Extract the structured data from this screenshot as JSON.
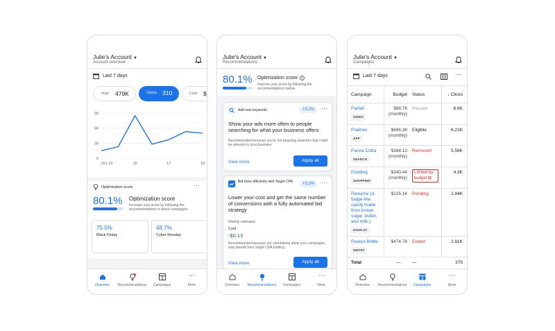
{
  "colors": {
    "accent": "#1a73e8",
    "error": "#d93025",
    "chart_line": "#1a73e8"
  },
  "phone1": {
    "account": "Julie's Account",
    "subtitle": "Account overview",
    "date_range": "Last 7 days",
    "metrics": [
      {
        "label": "Impr.",
        "value": "479K"
      },
      {
        "label": "Clicks",
        "value": "310"
      },
      {
        "label": "Cost",
        "value": "$"
      }
    ],
    "opt_section_label": "Optimization score",
    "opt_score": "80.1%",
    "opt_title": "Optimization score",
    "opt_desc": "Increase your score by following the recommendations in these campaigns",
    "campaign_scores": [
      {
        "score": "75.5%",
        "name": "Black Friday"
      },
      {
        "score": "48.7%",
        "name": "Cyber Monday"
      }
    ]
  },
  "chart_data": {
    "type": "line",
    "x": [
      "Oct 13",
      "14",
      "15",
      "16",
      "17",
      "18",
      "19"
    ],
    "x_tick_labels": [
      "Oct 13",
      "15",
      "17",
      "19"
    ],
    "values": [
      15,
      23,
      85,
      28,
      37,
      53,
      50
    ],
    "y_ticks": [
      "90",
      "60",
      "30",
      "0"
    ],
    "ylim": [
      0,
      90
    ],
    "xlabel": "",
    "ylabel": "",
    "title": ""
  },
  "phone2": {
    "account": "Julie's Account",
    "subtitle": "Recommendations",
    "score": "80.1%",
    "score_title": "Optimization score",
    "score_desc": "Improve your score by following the recommendations below",
    "score_progress": 0.801,
    "cards": [
      {
        "type_label": "Add new keywords",
        "uplift": "+3.2%",
        "headline": "Show your ads more often to people searching for what your business offers",
        "reason": "Recommended because you're not targeting searches that could be relevant to your business",
        "view": "View more",
        "apply": "Apply all"
      },
      {
        "type_label": "Bid more efficiently with Target CPA",
        "uplift": "+3.2%",
        "headline": "Lower your cost and get the same number of conversions with a fully automated bid strategy",
        "estimates_label": "Weekly estimates",
        "cost_label": "Cost",
        "cost_value": "-$0.13",
        "reason": "Recommended because our simulations show your campaigns may benefit from Target CPA bidding",
        "view": "View more",
        "apply": "Apply all"
      }
    ]
  },
  "phone3": {
    "account": "Julie's Account",
    "subtitle": "Campaigns",
    "date_range": "Last 7 days",
    "columns": [
      "Campaign",
      "Budget",
      "Status",
      "Clicks"
    ],
    "rows": [
      {
        "name": "Parfait",
        "type": "VIDEO",
        "budget": "$88.78",
        "period": "(monthly)",
        "status": "Paused",
        "clicks": "6.6K"
      },
      {
        "name": "Pralines",
        "type": "APP",
        "budget": "$666.38",
        "period": "(monthly)",
        "status": "Eligible",
        "clicks": "6.22K"
      },
      {
        "name": "Panna Cotta",
        "type": "SEARCH",
        "budget": "$368.13",
        "period": "(monthly)",
        "status": "Removed",
        "clicks": "5.56K"
      },
      {
        "name": "Pudding",
        "type": "SHOPPING",
        "budget": "$340.44",
        "period": "(monthly)",
        "status": "Limited by budget",
        "clicks": "4.3K"
      },
      {
        "name": "Penuche (A fudge-like candy made from brown sugar, butter, and milk.)",
        "type": "DISPLAY",
        "budget": "$225.14",
        "period": "",
        "status": "Pending",
        "clicks": "2.84K"
      },
      {
        "name": "Peanut Brittle",
        "type": "SMART",
        "budget": "$474.78",
        "period": "",
        "status": "Ended",
        "clicks": "2.81K"
      }
    ],
    "total": {
      "label": "Total",
      "budget": "—",
      "status": "—",
      "clicks": "375"
    }
  },
  "nav": [
    "Overview",
    "Recommendations",
    "Campaigns",
    "More"
  ]
}
